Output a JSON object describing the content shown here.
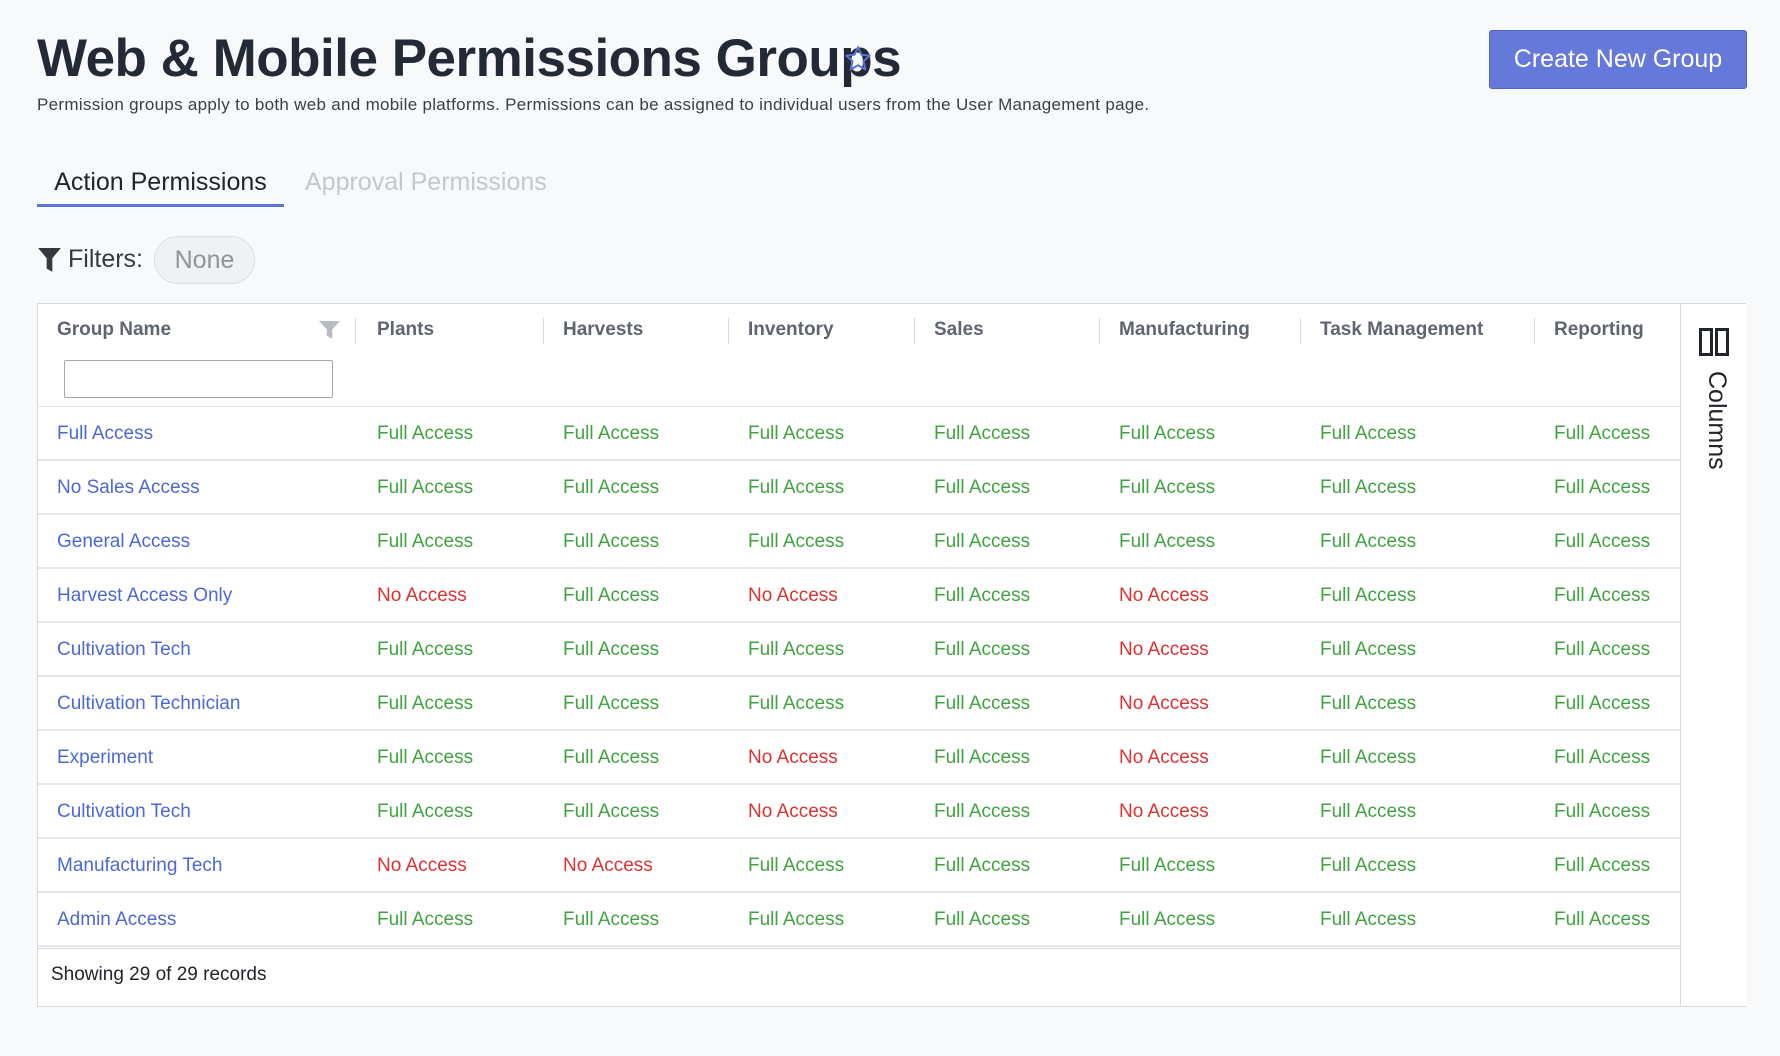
{
  "header": {
    "title": "Web & Mobile Permissions Groups",
    "subtitle": "Permission groups apply to both web and mobile platforms. Permissions can be assigned to individual users from the User Management page.",
    "create_button": "Create New Group"
  },
  "tabs": [
    {
      "label": "Action Permissions",
      "active": true
    },
    {
      "label": "Approval Permissions",
      "active": false
    }
  ],
  "filters": {
    "label": "Filters:",
    "value": "None"
  },
  "table": {
    "columns": [
      "Group Name",
      "Plants",
      "Harvests",
      "Inventory",
      "Sales",
      "Manufacturing",
      "Task Management",
      "Reporting"
    ],
    "name_filter_value": "",
    "rows": [
      {
        "name": "Full Access",
        "cells": [
          "Full Access",
          "Full Access",
          "Full Access",
          "Full Access",
          "Full Access",
          "Full Access",
          "Full Access"
        ]
      },
      {
        "name": "No Sales Access",
        "cells": [
          "Full Access",
          "Full Access",
          "Full Access",
          "Full Access",
          "Full Access",
          "Full Access",
          "Full Access"
        ]
      },
      {
        "name": "General Access",
        "cells": [
          "Full Access",
          "Full Access",
          "Full Access",
          "Full Access",
          "Full Access",
          "Full Access",
          "Full Access"
        ]
      },
      {
        "name": "Harvest Access Only",
        "cells": [
          "No Access",
          "Full Access",
          "No Access",
          "Full Access",
          "No Access",
          "Full Access",
          "Full Access"
        ]
      },
      {
        "name": "Cultivation Tech",
        "cells": [
          "Full Access",
          "Full Access",
          "Full Access",
          "Full Access",
          "No Access",
          "Full Access",
          "Full Access"
        ]
      },
      {
        "name": "Cultivation Technician",
        "cells": [
          "Full Access",
          "Full Access",
          "Full Access",
          "Full Access",
          "No Access",
          "Full Access",
          "Full Access"
        ]
      },
      {
        "name": "Experiment",
        "cells": [
          "Full Access",
          "Full Access",
          "No Access",
          "Full Access",
          "No Access",
          "Full Access",
          "Full Access"
        ]
      },
      {
        "name": "Cultivation Tech",
        "cells": [
          "Full Access",
          "Full Access",
          "No Access",
          "Full Access",
          "No Access",
          "Full Access",
          "Full Access"
        ]
      },
      {
        "name": "Manufacturing Tech",
        "cells": [
          "No Access",
          "No Access",
          "Full Access",
          "Full Access",
          "Full Access",
          "Full Access",
          "Full Access"
        ]
      },
      {
        "name": "Admin Access",
        "cells": [
          "Full Access",
          "Full Access",
          "Full Access",
          "Full Access",
          "Full Access",
          "Full Access",
          "Full Access"
        ]
      }
    ],
    "footer": "Showing 29 of 29 records"
  },
  "side_panel": {
    "label": "Columns"
  },
  "icons": {
    "favorite": "star-icon",
    "filter": "filter-icon",
    "column_filter": "column-filter-icon",
    "columns": "columns-icon"
  },
  "colors": {
    "accent": "#6479d9",
    "link": "#4c68d4",
    "full_access": "#3fa33f",
    "no_access": "#dc3232",
    "title": "#232a36"
  }
}
